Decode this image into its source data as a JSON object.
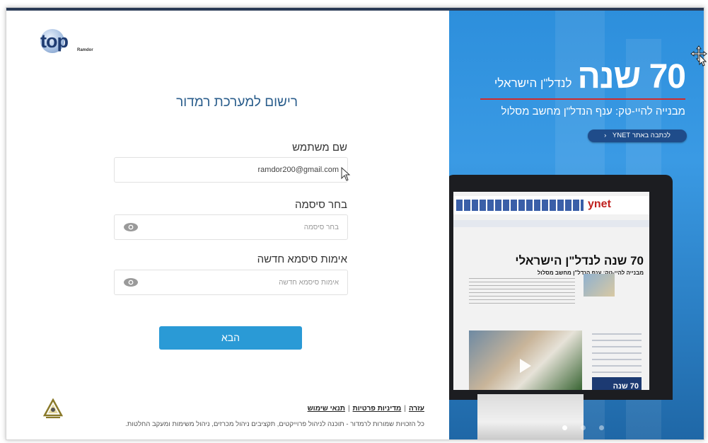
{
  "logo": {
    "text": "top",
    "sub": "Ramdor"
  },
  "form": {
    "title": "רישום למערכת רמדור",
    "username_label": "שם משתמש",
    "username_value": "ramdor200@gmail.com",
    "password_label": "בחר סיסמה",
    "password_placeholder": "בחר סיסמה",
    "confirm_label": "אימות סיסמא חדשה",
    "confirm_placeholder": "אימות סיסמא חדשה",
    "next_button": "הבא"
  },
  "footer": {
    "link_help": "עזרה",
    "link_privacy": "מדיניות פרטיות",
    "link_terms": "תנאי שימוש",
    "separator": "|",
    "copyright": "כל הזכויות שמורות לרמדור - תוכנה לניהול פרוייקטים, תקציבים ניהול מכרזים, ניהול משימות ומעקב החלטות."
  },
  "promo": {
    "big": "70 שנה",
    "small": "לנדל\"ן הישראלי",
    "subtitle": "מבנייה להיי-טק: ענף הנדל\"ן מחשב מסלול",
    "button": "לכתבה באתר YNET"
  },
  "mockup": {
    "site_logo": "ynet",
    "article_title": "70 שנה לנדל\"ן הישראלי",
    "article_sub": "מבנייה להיי-טק: ענף הנדל\"ן מחשב מסלול",
    "side_ad": "70 שנה"
  },
  "carousel": {
    "count": 3,
    "active": 0
  },
  "colors": {
    "title_blue": "#2b5e8c",
    "button_blue": "#2a9ad6",
    "promo_bg": "#2d8fdc",
    "promo_red_line": "#d02b2b"
  },
  "icons": [
    "eye-icon",
    "chevron-left-icon",
    "seal-icon",
    "move-cursor-icon",
    "pointer-cursor-icon"
  ]
}
